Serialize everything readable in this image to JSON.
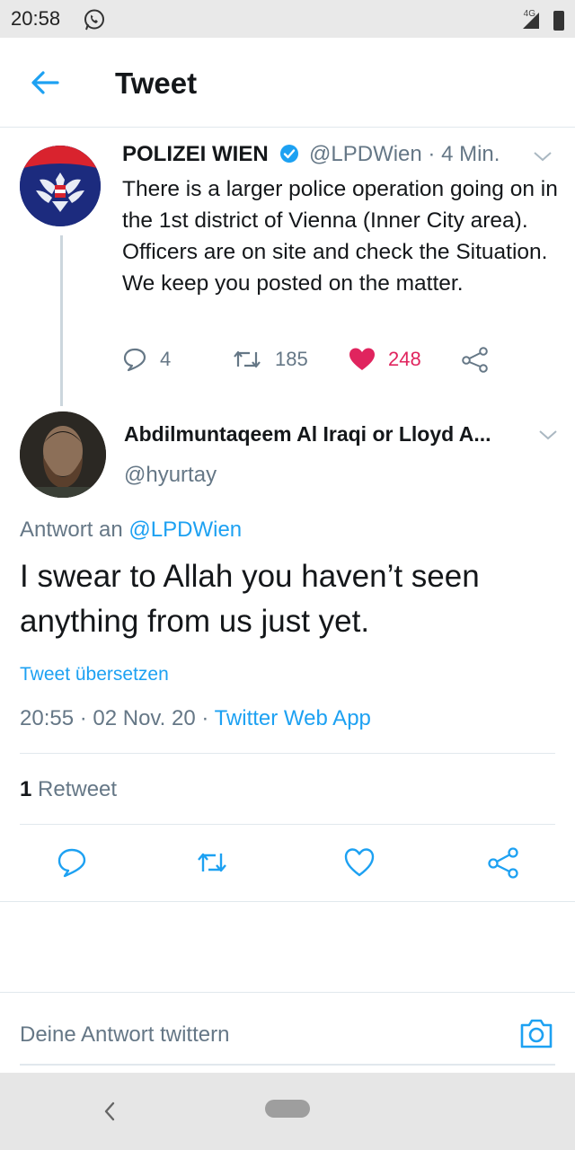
{
  "status_bar": {
    "time": "20:58",
    "network": "4G",
    "icons": [
      "whatsapp-icon",
      "signal-icon",
      "battery-icon"
    ]
  },
  "header": {
    "title": "Tweet",
    "back_icon": "arrow-left-icon"
  },
  "original_tweet": {
    "display_name": "POLIZEI WIEN",
    "handle_time": "@LPDWien · 4 Min.",
    "text": "There is a larger police operation going on in the 1st district of Vienna (Inner City area). Officers are on site and check the Situation. We keep you posted on the matter.",
    "replies": "4",
    "retweets": "185",
    "likes": "248",
    "liked": true
  },
  "reply_tweet": {
    "display_name": "Abdilmuntaqeem Al Iraqi or Lloyd A...",
    "handle": "@hyurtay",
    "reply_prefix": "Antwort an",
    "reply_mention": "@LPDWien",
    "text": "I swear to Allah you haven’t seen anything from us just yet.",
    "translate_label": "Tweet übersetzen",
    "timestamp": "20:55 · 02 Nov. 20 · ",
    "source": "Twitter Web App",
    "retweet_count": "1",
    "retweet_label": " Retweet"
  },
  "reply_box": {
    "placeholder": "Deine Antwort twittern"
  },
  "colors": {
    "accent": "#1da1f2",
    "secondary_text": "#657786",
    "like": "#e0245e",
    "divider": "#e1e8ed"
  }
}
